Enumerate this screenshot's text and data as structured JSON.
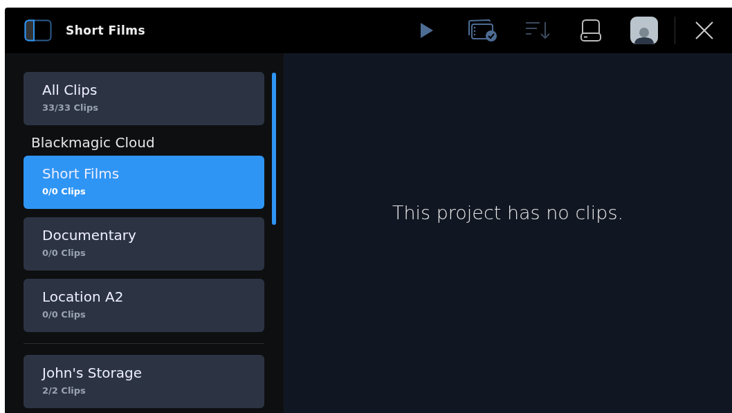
{
  "top_bar": {
    "title": "Short Films"
  },
  "sidebar": {
    "sections": [
      {
        "items": [
          {
            "name": "All Clips",
            "count": "33/33 Clips",
            "selected": false
          }
        ]
      },
      {
        "heading": "Blackmagic Cloud",
        "items": [
          {
            "name": "Short Films",
            "count": "0/0 Clips",
            "selected": true
          },
          {
            "name": "Documentary",
            "count": "0/0 Clips",
            "selected": false
          },
          {
            "name": "Location A2",
            "count": "0/0 Clips",
            "selected": false
          }
        ]
      },
      {
        "items": [
          {
            "name": "John's Storage",
            "count": "2/2 Clips",
            "selected": false
          }
        ]
      }
    ]
  },
  "main": {
    "message": "This project has no clips."
  }
}
